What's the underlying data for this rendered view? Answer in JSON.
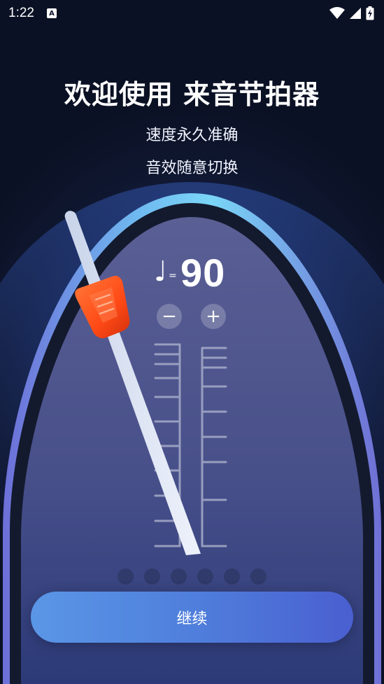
{
  "status_bar": {
    "time": "1:22",
    "notification_icon": "a-box-icon",
    "icons": [
      "wifi-icon",
      "cellular-signal-icon",
      "battery-charging-icon"
    ]
  },
  "welcome": {
    "title": "欢迎使用 来音节拍器",
    "subtitle_1": "速度永久准确",
    "subtitle_2": "音效随意切换"
  },
  "metronome": {
    "note_symbol": "♩",
    "equals": "=",
    "tempo": "90",
    "decrease_label": "−",
    "increase_label": "+",
    "page_dots": 6
  },
  "actions": {
    "continue_label": "继续"
  },
  "colors": {
    "background": "#0f1730",
    "dome_rim": "#7fd4f5",
    "dome_face": "#4a5484",
    "pendulum_weight": "#ff4a16",
    "button_start": "#5a96e6",
    "button_end": "#4a5fd0"
  }
}
